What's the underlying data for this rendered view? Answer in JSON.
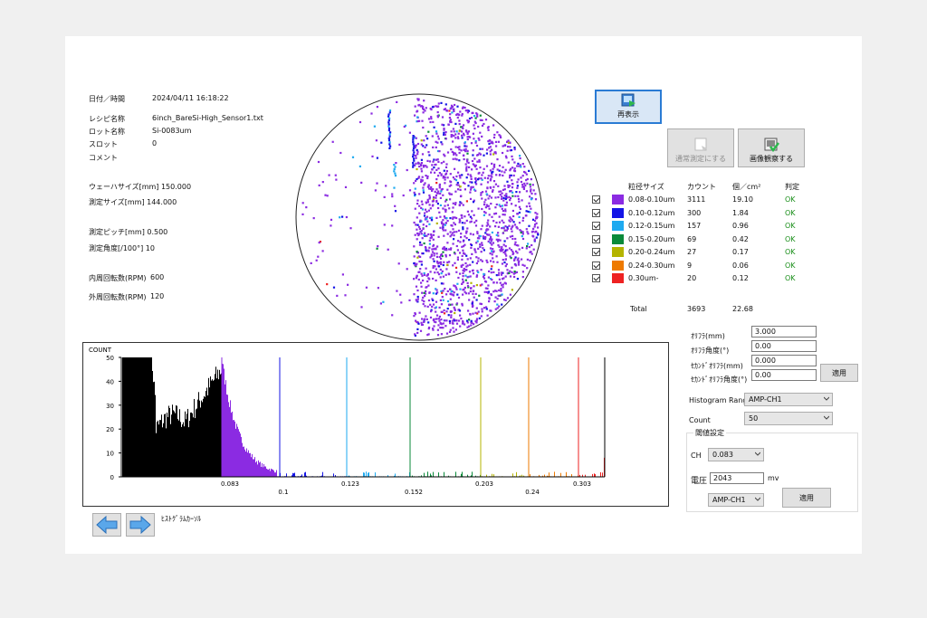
{
  "info": {
    "datetime": {
      "label": "日付／時間",
      "value": "2024/04/11 16:18:22"
    },
    "recipe": {
      "label": "レシピ名称",
      "value": "6inch_BareSi-High_Sensor1.txt"
    },
    "lot": {
      "label": "ロット名称",
      "value": "Si-0083um"
    },
    "slot": {
      "label": "スロット",
      "value": "0"
    },
    "comment": {
      "label": "コメント",
      "value": ""
    },
    "wafer_size": "ウェーハサイズ[mm] 150.000",
    "measure_size": "測定サイズ[mm] 144.000",
    "pitch": "測定ピッチ[mm] 0.500",
    "angle": "測定角度[/100°] 10",
    "inner_rpm": {
      "label": "内周回転数(RPM)",
      "value": "600"
    },
    "outer_rpm": {
      "label": "外周回転数(RPM)",
      "value": "120"
    }
  },
  "buttons": {
    "redisplay": "再表示",
    "normal_measure": "通常測定にする",
    "image_observe": "画像観察する",
    "apply1": "適用",
    "apply2": "適用"
  },
  "legend": {
    "headers": {
      "size": "粒径サイズ",
      "count": "カウント",
      "density": "個／cm²",
      "judge": "判定"
    },
    "rows": [
      {
        "color": "#8b2be2",
        "label": "0.08-0.10um",
        "count": "3111",
        "density": "19.10",
        "judge": "OK"
      },
      {
        "color": "#1414e6",
        "label": "0.10-0.12um",
        "count": "300",
        "density": "1.84",
        "judge": "OK"
      },
      {
        "color": "#1eaaf0",
        "label": "0.12-0.15um",
        "count": "157",
        "density": "0.96",
        "judge": "OK"
      },
      {
        "color": "#0a8a3a",
        "label": "0.15-0.20um",
        "count": "69",
        "density": "0.42",
        "judge": "OK"
      },
      {
        "color": "#b4b400",
        "label": "0.20-0.24um",
        "count": "27",
        "density": "0.17",
        "judge": "OK"
      },
      {
        "color": "#ee7a00",
        "label": "0.24-0.30um",
        "count": "9",
        "density": "0.06",
        "judge": "OK"
      },
      {
        "color": "#ee2222",
        "label": "0.30um-",
        "count": "20",
        "density": "0.12",
        "judge": "OK"
      }
    ],
    "total_label": "Total",
    "total_count": "3693",
    "total_density": "22.68"
  },
  "params": {
    "orifura": {
      "label": "ｵﾘﾌﾗ(mm)",
      "value": "3.000"
    },
    "orifura_angle": {
      "label": "ｵﾘﾌﾗ角度(°)",
      "value": "0.00"
    },
    "second_orifura": {
      "label": "ｾｶﾝﾄﾞｵﾘﾌﾗ(mm)",
      "value": "0.000"
    },
    "second_orifura_angle": {
      "label": "ｾｶﾝﾄﾞｵﾘﾌﾗ角度(°)",
      "value": "0.00"
    },
    "hist_range": {
      "label": "Histogram Range",
      "value": "AMP-CH1"
    },
    "count": {
      "label": "Count",
      "value": "50"
    },
    "threshold_title": "閾値設定",
    "ch": {
      "label": "CH",
      "value": "0.083"
    },
    "voltage": {
      "label": "電圧",
      "value": "2043",
      "unit": "mv"
    },
    "amp": "AMP-CH1"
  },
  "hist_cursor_label": "ﾋｽﾄｸﾞﾗﾑｶｰｿﾙ",
  "chart_data": {
    "type": "bar",
    "ylabel": "COUNT",
    "ylim": [
      0,
      50
    ],
    "y_ticks": [
      "50",
      "40",
      "30",
      "20",
      "10",
      "0"
    ],
    "x_ticks": [
      "0.083",
      "0.1",
      "0.123",
      "0.152",
      "0.203",
      "0.24",
      "0.303"
    ],
    "thresholds": [
      {
        "x": "0.083",
        "color": "#8b2be2"
      },
      {
        "x": "0.1",
        "color": "#1414e6"
      },
      {
        "x": "0.123",
        "color": "#1eaaf0"
      },
      {
        "x": "0.152",
        "color": "#0a8a3a"
      },
      {
        "x": "0.203",
        "color": "#b4b400"
      },
      {
        "x": "0.24",
        "color": "#ee7a00"
      },
      {
        "x": "0.303",
        "color": "#ee2222"
      }
    ]
  }
}
